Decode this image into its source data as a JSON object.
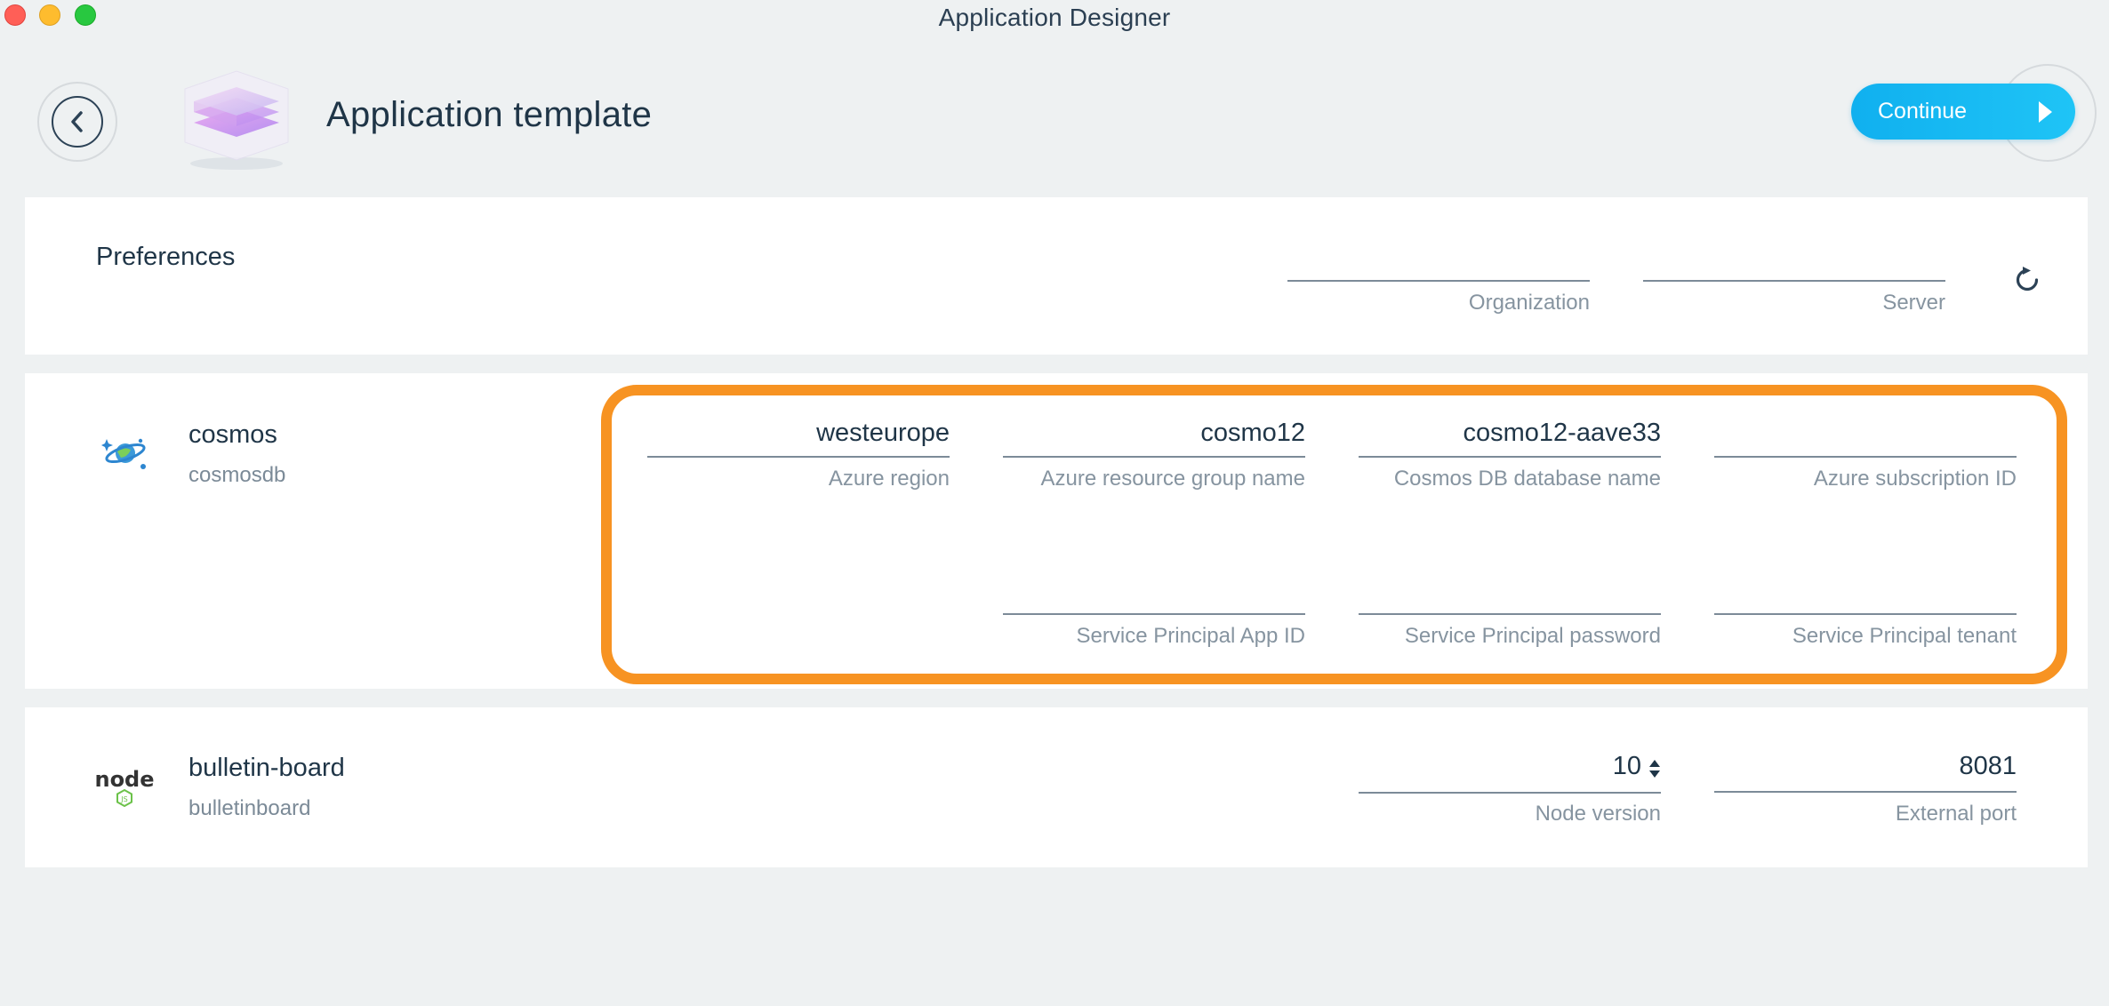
{
  "window": {
    "title": "Application Designer"
  },
  "header": {
    "back_icon": "chevron-left-icon",
    "title": "Application template",
    "continue_label": "Continue",
    "accent_color": "#15b6f2"
  },
  "preferences": {
    "title": "Preferences",
    "fields": [
      {
        "label": "Organization",
        "value": ""
      },
      {
        "label": "Server",
        "value": ""
      }
    ],
    "reset_icon": "refresh-icon"
  },
  "services": [
    {
      "name": "cosmos",
      "type": "cosmosdb",
      "icon": "cosmosdb-icon",
      "fields": [
        {
          "label": "Azure region",
          "value": "westeurope"
        },
        {
          "label": "Azure resource group name",
          "value": "cosmo12"
        },
        {
          "label": "Cosmos DB database name",
          "value": "cosmo12-aave33"
        },
        {
          "label": "Azure subscription ID",
          "value": ""
        },
        {
          "label": "Service Principal App ID",
          "value": ""
        },
        {
          "label": "Service Principal password",
          "value": ""
        },
        {
          "label": "Service Principal tenant",
          "value": ""
        }
      ],
      "highlight_color": "#f79322"
    },
    {
      "name": "bulletin-board",
      "type": "bulletinboard",
      "icon": "nodejs-icon",
      "icon_text": "node",
      "fields": [
        {
          "label": "Node version",
          "value": "10"
        },
        {
          "label": "External port",
          "value": "8081"
        }
      ]
    }
  ]
}
